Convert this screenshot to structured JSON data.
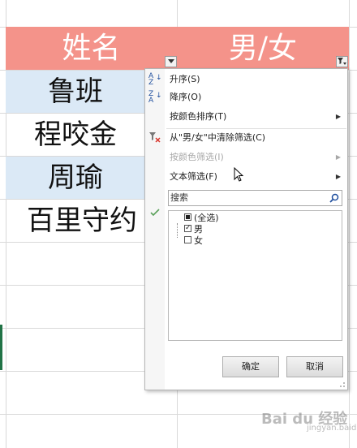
{
  "sheet": {
    "header": {
      "name_col": "姓名",
      "gender_col": "男/女"
    },
    "rows": [
      {
        "name": "鲁班"
      },
      {
        "name": "程咬金"
      },
      {
        "name": "周瑜"
      },
      {
        "name": "百里守约"
      }
    ]
  },
  "filter_menu": {
    "items": [
      {
        "label": "升序(S)",
        "icon": "sort-ascending-icon",
        "enabled": true
      },
      {
        "label": "降序(O)",
        "icon": "sort-descending-icon",
        "enabled": true
      },
      {
        "label": "按颜色排序(T)",
        "submenu": true,
        "enabled": true
      },
      {
        "label": "从\"男/女\"中清除筛选(C)",
        "icon": "clear-filter-icon",
        "enabled": true
      },
      {
        "label": "按颜色筛选(I)",
        "submenu": true,
        "enabled": false
      },
      {
        "label": "文本筛选(F)",
        "submenu": true,
        "enabled": true
      }
    ],
    "search_placeholder": "搜索",
    "list": [
      {
        "label": "(全选)",
        "state": "partial"
      },
      {
        "label": "男",
        "state": "checked"
      },
      {
        "label": "女",
        "state": "unchecked"
      }
    ],
    "ok_label": "确定",
    "cancel_label": "取消"
  },
  "watermark": {
    "text": "Bai du 经验",
    "sub": "jingyan.baidu.com"
  },
  "colors": {
    "header_bg": "#f4938a",
    "band_bg": "#dbe9f6",
    "accent": "#1f4f9e"
  }
}
